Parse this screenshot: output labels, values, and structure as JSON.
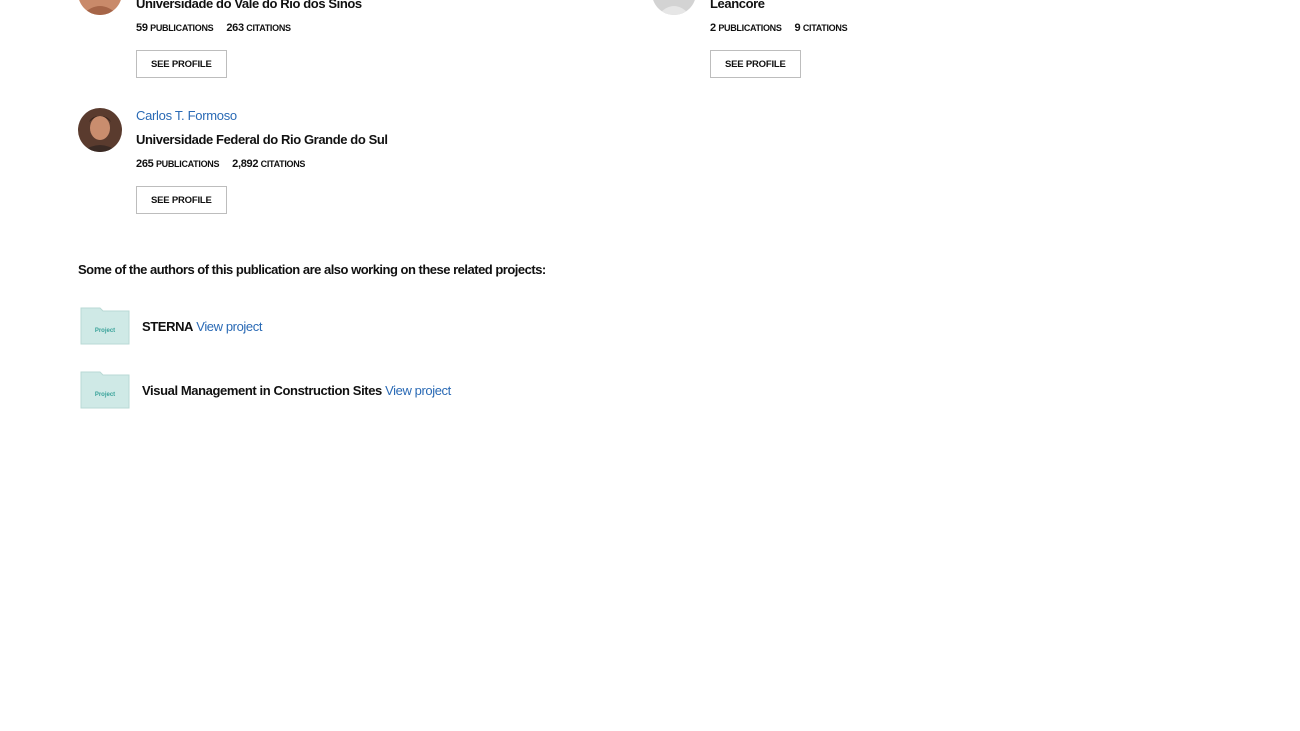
{
  "authors": [
    {
      "name": "",
      "affiliation": "Universidade do Vale do Rio dos Sinos",
      "publications": "59",
      "citations": "263",
      "publications_label": "PUBLICATIONS",
      "citations_label": "CITATIONS",
      "button": "SEE PROFILE"
    },
    {
      "name": "",
      "affiliation": "Leancore",
      "publications": "2",
      "citations": "9",
      "publications_label": "PUBLICATIONS",
      "citations_label": "CITATIONS",
      "button": "SEE PROFILE"
    },
    {
      "name": "Carlos T. Formoso",
      "affiliation": "Universidade Federal do Rio Grande do Sul",
      "publications": "265",
      "citations": "2,892",
      "publications_label": "PUBLICATIONS",
      "citations_label": "CITATIONS",
      "button": "SEE PROFILE"
    }
  ],
  "related": {
    "heading": "Some of the authors of this publication are also working on these related projects:",
    "projects": [
      {
        "icon_label": "Project",
        "title": "STERNA",
        "link": "View project"
      },
      {
        "icon_label": "Project",
        "title": "Visual Management in Construction Sites",
        "link": "View project"
      }
    ]
  },
  "colors": {
    "link": "#2a6ab5",
    "folder": "#cfe9e6",
    "folder_text": "#3aa39a"
  },
  "icons": {
    "folder": "project-folder-icon"
  }
}
